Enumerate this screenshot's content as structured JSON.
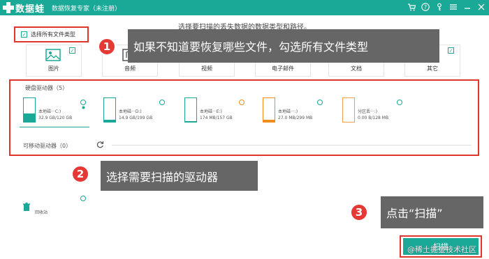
{
  "app": {
    "name": "数据蛙",
    "subtitle": "数据恢复专家（未注册）"
  },
  "instruction": "选择要扫描的丢失数据的数据类型和路径。",
  "select_all": {
    "label": "选择所有文件类型",
    "checked": true
  },
  "file_types": [
    {
      "label": "图片",
      "icon": "image-icon",
      "checked": true
    },
    {
      "label": "音频",
      "icon": "audio-icon",
      "checked": false
    },
    {
      "label": "视频",
      "icon": "video-icon",
      "checked": false
    },
    {
      "label": "电子邮件",
      "icon": "email-icon",
      "checked": false
    },
    {
      "label": "文档",
      "icon": "document-icon",
      "checked": false
    },
    {
      "label": "其它",
      "icon": "other-icon",
      "checked": true
    }
  ],
  "callouts": [
    {
      "num": "1",
      "text": "如果不知道要恢复哪些文件，勾选所有文件类型"
    },
    {
      "num": "2",
      "text": "选择需要扫描的驱动器"
    },
    {
      "num": "3",
      "text": "点击“扫描”"
    }
  ],
  "hard_drives": {
    "label": "硬盘驱动器（5）",
    "items": [
      {
        "name": "本地磁···C:)",
        "size": "32.9 GB/120 GB",
        "selected": true,
        "used_fraction": 0.27,
        "color": "#1aa897"
      },
      {
        "name": "本地磁···D:)",
        "size": "14.9 GB/199 GB",
        "selected": false,
        "used_fraction": 0.07,
        "color": "#1aa897"
      },
      {
        "name": "本地磁···E:)",
        "size": "174 MB/157 GB",
        "selected": false,
        "used_fraction": 0.0,
        "color": "#1aa897"
      },
      {
        "name": "本地磁···:)",
        "size": "27.0 MB/299 MB",
        "selected": false,
        "used_fraction": 0.09,
        "color": "#f08c1a"
      },
      {
        "name": "分区丢···:)",
        "size": "0.00  B/128 MB",
        "selected": false,
        "used_fraction": 0.0,
        "color": "#f0a04a"
      }
    ]
  },
  "removable": {
    "label": "可移动驱动器（0）"
  },
  "recycle": {
    "label": "回收站"
  },
  "scan_button": {
    "label": "扫描"
  },
  "watermark": "@稀土掘金技术社区",
  "colors": {
    "accent": "#1aa897",
    "highlight": "#e0352b",
    "callout_bg": "#666666",
    "badge": "#e53935"
  }
}
